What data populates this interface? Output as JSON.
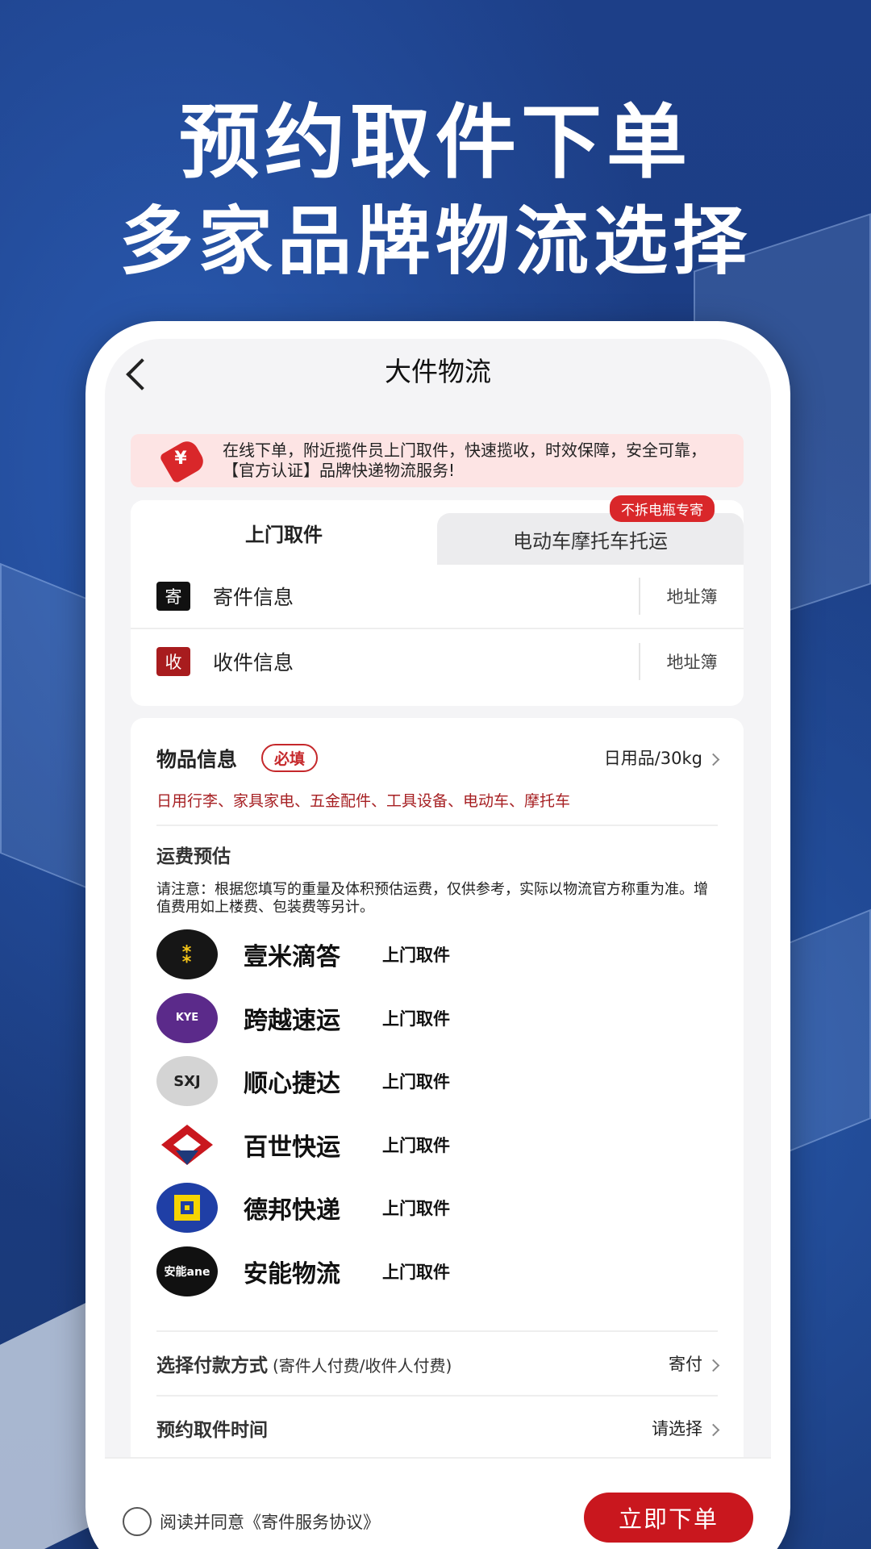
{
  "headline": {
    "line1": "预约取件下单",
    "line2": "多家品牌物流选择"
  },
  "nav": {
    "title": "大件物流"
  },
  "notice": {
    "text": "在线下单，附近揽件员上门取件，快速揽收，时效保障，安全可靠，【官方认证】品牌快递物流服务!"
  },
  "tabs": {
    "active": "上门取件",
    "inactive": "电动车摩托车托运",
    "badge": "不拆电瓶专寄"
  },
  "address": {
    "sender_icon": "寄",
    "sender_label": "寄件信息",
    "receiver_icon": "收",
    "receiver_label": "收件信息",
    "book_label": "地址簿"
  },
  "goods": {
    "title": "物品信息",
    "required": "必填",
    "value": "日用品/30kg",
    "tags": "日用行李、家具家电、五金配件、工具设备、电动车、摩托车"
  },
  "fee": {
    "title": "运费预估",
    "note": "请注意：根据您填写的重量及体积预估运费，仅供参考，实际以物流官方称重为准。增值费用如上楼费、包装费等另计。"
  },
  "carriers": [
    {
      "name": "壹米滴答",
      "tag": "上门取件",
      "logo": "⁑"
    },
    {
      "name": "跨越速运",
      "tag": "上门取件",
      "logo": "KYE"
    },
    {
      "name": "顺心捷达",
      "tag": "上门取件",
      "logo": "SXJ"
    },
    {
      "name": "百世快运",
      "tag": "上门取件",
      "logo": ""
    },
    {
      "name": "德邦快递",
      "tag": "上门取件",
      "logo": ""
    },
    {
      "name": "安能物流",
      "tag": "上门取件",
      "logo": "安能ane"
    }
  ],
  "payment": {
    "label": "选择付款方式",
    "hint": "(寄件人付费/收件人付费)",
    "value": "寄付"
  },
  "pickup_time": {
    "label": "预约取件时间",
    "value": "请选择"
  },
  "bottom": {
    "agree_text": "阅读并同意《寄件服务协议》",
    "submit": "立即下单"
  },
  "colors": {
    "brand_red": "#c9171e",
    "background_blue": "#1c3f86"
  }
}
